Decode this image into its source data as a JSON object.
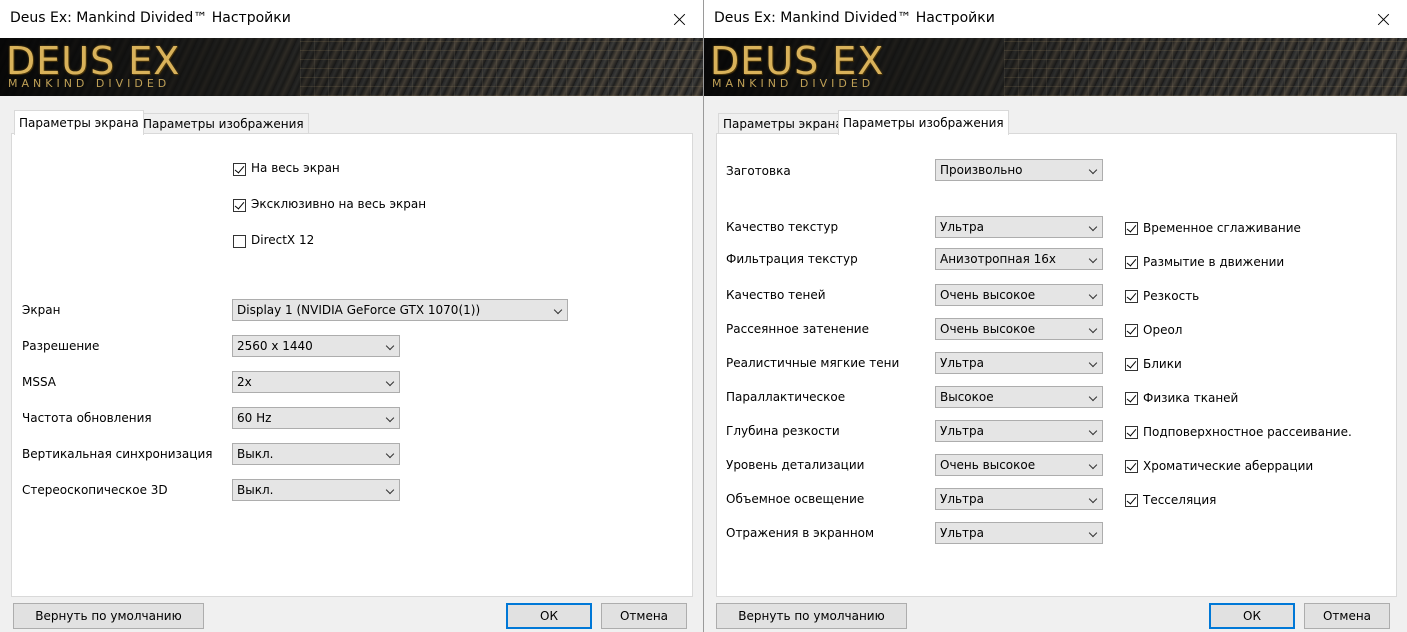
{
  "left": {
    "title": "Deus Ex: Mankind Divided™ Настройки",
    "banner": {
      "logo": "DEUS EX",
      "logo_sub": "MANKIND DIVIDED"
    },
    "tabs": [
      "Параметры экрана",
      "Параметры изображения"
    ],
    "active_tab": "Параметры экрана",
    "checkboxes": [
      {
        "label": "На весь экран",
        "checked": true
      },
      {
        "label": "Эксклюзивно на весь экран",
        "checked": true
      },
      {
        "label": "DirectX 12",
        "checked": false
      }
    ],
    "settings": [
      {
        "label": "Экран",
        "value": "Display 1 (NVIDIA GeForce GTX 1070(1))"
      },
      {
        "label": "Разрешение",
        "value": "2560 x 1440"
      },
      {
        "label": "MSSA",
        "value": "2x"
      },
      {
        "label": "Частота обновления",
        "value": "60 Hz"
      },
      {
        "label": "Вертикальная синхронизация",
        "value": "Выкл."
      },
      {
        "label": "Стереоскопическое 3D",
        "value": "Выкл."
      }
    ],
    "buttons": {
      "reset": "Вернуть по умолчанию",
      "ok": "ОК",
      "cancel": "Отмена"
    }
  },
  "right": {
    "title": "Deus Ex: Mankind Divided™ Настройки",
    "banner": {
      "logo": "DEUS EX",
      "logo_sub": "MANKIND DIVIDED"
    },
    "tabs": [
      "Параметры экрана",
      "Параметры изображения"
    ],
    "active_tab": "Параметры изображения",
    "preset": {
      "label": "Заготовка",
      "value": "Произвольно"
    },
    "settings": [
      {
        "label": "Качество текстур",
        "value": "Ультра"
      },
      {
        "label": "Фильтрация текстур",
        "value": "Анизотропная 16x"
      },
      {
        "label": "Качество теней",
        "value": "Очень высокое"
      },
      {
        "label": "Рассеянное затенение",
        "value": "Очень высокое"
      },
      {
        "label": "Реалистичные мягкие тени",
        "value": "Ультра"
      },
      {
        "label": "Параллактическое",
        "value": "Высокое"
      },
      {
        "label": "Глубина резкости",
        "value": "Ультра"
      },
      {
        "label": "Уровень детализации",
        "value": "Очень высокое"
      },
      {
        "label": "Объемное освещение",
        "value": "Ультра"
      },
      {
        "label": "Отражения в экранном",
        "value": "Ультра"
      }
    ],
    "checkboxes": [
      {
        "label": "Временное сглаживание",
        "checked": true
      },
      {
        "label": "Размытие в движении",
        "checked": true
      },
      {
        "label": "Резкость",
        "checked": true
      },
      {
        "label": "Ореол",
        "checked": true
      },
      {
        "label": "Блики",
        "checked": true
      },
      {
        "label": "Физика тканей",
        "checked": true
      },
      {
        "label": "Подповерхностное рассеивание.",
        "checked": true
      },
      {
        "label": "Хроматические аберрации",
        "checked": true
      },
      {
        "label": "Тесселяция",
        "checked": true
      }
    ],
    "buttons": {
      "reset": "Вернуть по умолчанию",
      "ok": "ОК",
      "cancel": "Отмена"
    }
  }
}
